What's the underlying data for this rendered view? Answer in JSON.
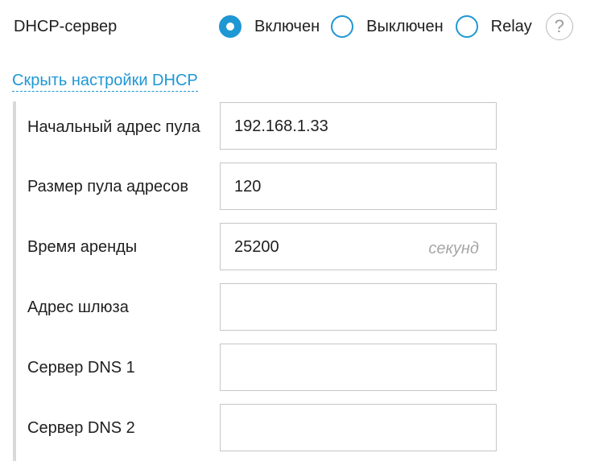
{
  "dhcp": {
    "label": "DHCP-сервер",
    "options": [
      {
        "label": "Включен",
        "selected": true
      },
      {
        "label": "Выключен",
        "selected": false
      },
      {
        "label": "Relay",
        "selected": false
      }
    ],
    "help_icon": "question-circle-icon",
    "help_glyph": "?"
  },
  "toggle_link": "Скрыть настройки DHCP",
  "fields": [
    {
      "label": "Начальный адрес пула",
      "value": "192.168.1.33",
      "unit": ""
    },
    {
      "label": "Размер пула адресов",
      "value": "120",
      "unit": ""
    },
    {
      "label": "Время аренды",
      "value": "25200",
      "unit": "секунд"
    },
    {
      "label": "Адрес шлюза",
      "value": "",
      "unit": ""
    },
    {
      "label": "Сервер DNS 1",
      "value": "",
      "unit": ""
    },
    {
      "label": "Сервер DNS 2",
      "value": "",
      "unit": ""
    }
  ],
  "colors": {
    "accent": "#1f97d4",
    "text": "#1f1f1f",
    "border": "#c6c6c6",
    "muted": "#a6a6a6",
    "bar": "#d9d9d9"
  }
}
